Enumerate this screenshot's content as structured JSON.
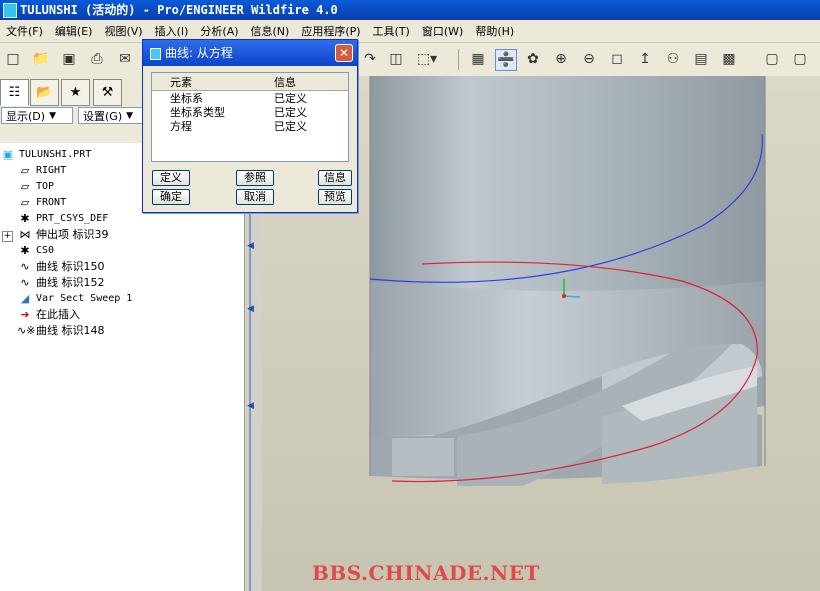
{
  "window": {
    "title": "TULUNSHI (活动的) - Pro/ENGINEER Wildfire 4.0"
  },
  "menu": [
    "文件(F)",
    "编辑(E)",
    "视图(V)",
    "插入(I)",
    "分析(A)",
    "信息(N)",
    "应用程序(P)",
    "工具(T)",
    "窗口(W)",
    "帮助(H)"
  ],
  "left_panel": {
    "show_label": "显示(D)",
    "settings_label": "设置(G)"
  },
  "tree": {
    "items": [
      {
        "label": "TULUNSHI.PRT",
        "icon": "part-icon"
      },
      {
        "label": "RIGHT",
        "icon": "datum-plane-icon"
      },
      {
        "label": "TOP",
        "icon": "datum-plane-icon"
      },
      {
        "label": "FRONT",
        "icon": "datum-plane-icon"
      },
      {
        "label": "PRT_CSYS_DEF",
        "icon": "csys-icon"
      },
      {
        "label": "伸出项 标识39",
        "icon": "protrusion-icon"
      },
      {
        "label": "CS0",
        "icon": "csys-icon"
      },
      {
        "label": "曲线 标识150",
        "icon": "curve-icon"
      },
      {
        "label": "曲线 标识152",
        "icon": "curve-icon"
      },
      {
        "label": "Var Sect Sweep 1",
        "icon": "sweep-icon"
      },
      {
        "label": "在此插入",
        "icon": "insert-arrow-icon"
      },
      {
        "label": "曲线 标识148",
        "icon": "curve-icon"
      }
    ]
  },
  "dialog": {
    "title": "曲线: 从方程",
    "col_element": "元素",
    "col_info": "信息",
    "rows": [
      {
        "element": "坐标系",
        "info": "已定义"
      },
      {
        "element": "坐标系类型",
        "info": "已定义"
      },
      {
        "element": "方程",
        "info": "已定义"
      }
    ],
    "buttons": {
      "define": "定义",
      "reference": "参照",
      "info": "信息",
      "ok": "确定",
      "cancel": "取消",
      "preview": "预览"
    }
  },
  "watermark": "BBS.CHINADE.NET",
  "colors": {
    "titlebar": "#0a4fc8",
    "cylinder": "#b3bcc2",
    "blue_curve": "#2a3fe0",
    "red_curve": "#e0203a"
  }
}
